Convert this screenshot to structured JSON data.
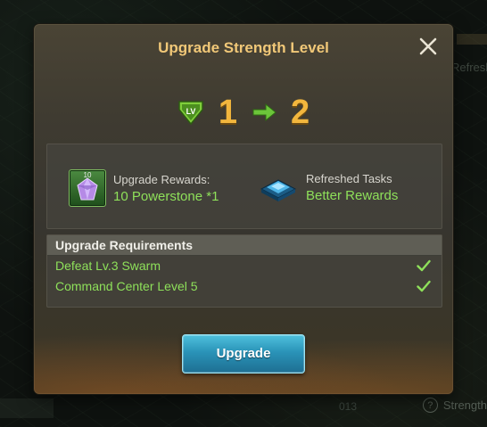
{
  "dialog": {
    "title": "Upgrade Strength Level",
    "close_icon": "close-icon"
  },
  "level": {
    "badge_label": "LV",
    "from": "1",
    "to": "2",
    "arrow_icon": "arrow-right-icon"
  },
  "rewards": {
    "upgrade": {
      "icon": "powerstone-icon",
      "icon_qty": "10",
      "label": "Upgrade Rewards:",
      "value": "10 Powerstone *1"
    },
    "tasks": {
      "icon": "refresh-chip-icon",
      "label": "Refreshed Tasks",
      "value": "Better Rewards"
    }
  },
  "requirements": {
    "header": "Upgrade Requirements",
    "items": [
      {
        "label": "Defeat Lv.3 Swarm",
        "met": true
      },
      {
        "label": "Command Center Level 5",
        "met": true
      }
    ]
  },
  "upgrade_button": {
    "label": "Upgrade"
  },
  "background": {
    "right_text": "Refreshe",
    "bottom_right_text": "Strength",
    "bottom_mid_text": "013",
    "help_glyph": "?"
  },
  "colors": {
    "title": "#f1c878",
    "level_number": "#f2b63d",
    "green_text": "#8ee05a",
    "button": "#2a93b8"
  }
}
